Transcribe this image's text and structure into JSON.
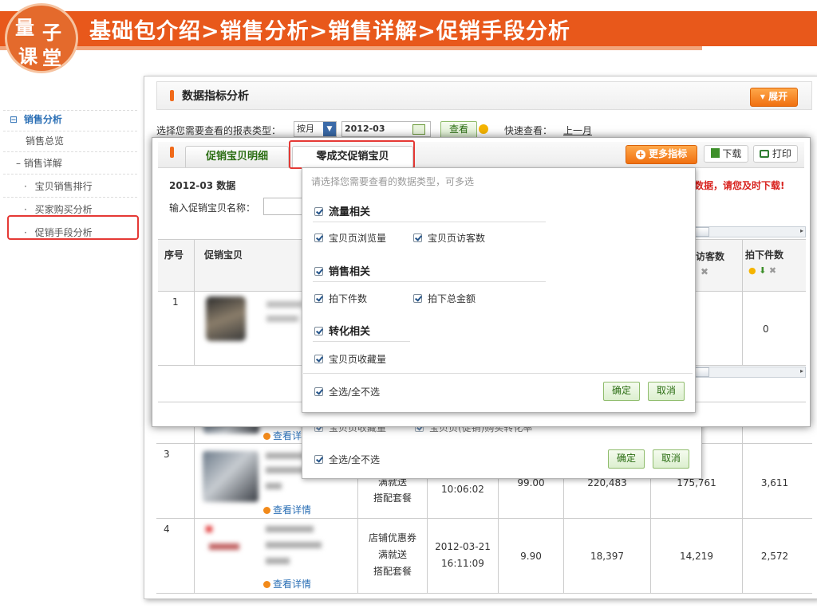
{
  "header": {
    "logo_chars": [
      "量",
      "子",
      "课",
      "堂"
    ],
    "title": "基础包介绍>销售分析>销售详解>促销手段分析",
    "bar_color": "#e8581b"
  },
  "sidebar": {
    "items": [
      {
        "prefix": "⊟",
        "label": "销售分析"
      },
      {
        "prefix": "",
        "label": "销售总览"
      },
      {
        "prefix": "–",
        "label": "销售详解"
      },
      {
        "prefix": "·",
        "label": "宝贝销售排行"
      },
      {
        "prefix": "·",
        "label": "买家购买分析"
      },
      {
        "prefix": "·",
        "label": "促销手段分析"
      }
    ]
  },
  "panel": {
    "title": "数据指标分析",
    "expand_label": "展开",
    "report_type_label": "选择您需要查看的报表类型：",
    "period_value": "按月",
    "month_value": "2012-03",
    "view_button": "查看",
    "quick_view_label": "快速查看：",
    "quick_prev": "上一月"
  },
  "tabs": {
    "items": [
      "促销宝贝明细",
      "零成交促销宝贝"
    ],
    "active": 1,
    "more_metrics": "更多指标",
    "download": "下载",
    "print": "打印"
  },
  "content": {
    "data_caption": "2012-03 数据",
    "search_label": "输入促销宝贝名称：",
    "notice": "数据，请您及时下载!",
    "col_index": "序号",
    "col_item": "促销宝贝",
    "col_visitors": "访客数",
    "col_pieces": "拍下件数",
    "row1_index": "1",
    "row1_pieces": "0"
  },
  "dropdown": {
    "hint": "请选择您需要查看的数据类型，可多选",
    "groups": [
      {
        "title": "流量相关",
        "options": [
          "宝贝页浏览量",
          "宝贝页访客数"
        ]
      },
      {
        "title": "销售相关",
        "options": [
          "拍下件数",
          "拍下总金额"
        ]
      },
      {
        "title": "转化相关",
        "options": [
          "宝贝页收藏量"
        ]
      }
    ],
    "select_all": "全选/全不选",
    "confirm": "确定",
    "cancel": "取消"
  },
  "back_dropdown": {
    "partial_opt1": "宝贝页收藏量",
    "partial_opt2": "宝贝页(促销)购买转化率",
    "select_all": "全选/全不选",
    "confirm": "确定",
    "cancel": "取消"
  },
  "table": {
    "detail_label": "查看详情",
    "rows": [
      {
        "index": "3",
        "promo": [
          "满就送",
          "搭配套餐"
        ],
        "time": "10:06:02",
        "price": "99.00",
        "pageviews": "220,483",
        "visitors": "175,761",
        "pieces": "3,611"
      },
      {
        "index": "4",
        "promo": [
          "店铺优惠券",
          "满就送",
          "搭配套餐"
        ],
        "date": "2012-03-21",
        "time": "16:11:09",
        "price": "9.90",
        "pageviews": "18,397",
        "visitors": "14,219",
        "pieces": "2,572"
      }
    ]
  }
}
